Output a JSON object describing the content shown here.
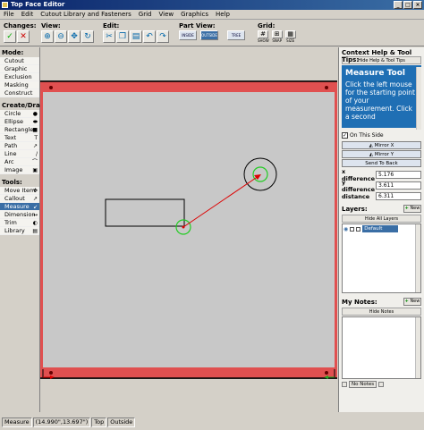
{
  "window": {
    "title": "Top Face Editor"
  },
  "menu": [
    "File",
    "Edit",
    "Cutout Library and Fasteners",
    "Grid",
    "View",
    "Graphics",
    "Help"
  ],
  "toolbar": {
    "changes_label": "Changes:",
    "view_label": "View:",
    "edit_label": "Edit:",
    "partview_label": "Part View:",
    "grid_label": "Grid:",
    "partview_buttons": [
      "INSIDE",
      "OUTSIDE",
      "TREE"
    ],
    "grid_buttons": [
      "SHOW",
      "SNAP",
      "SIZE"
    ]
  },
  "left_panel": {
    "mode_title": "Mode:",
    "mode_items": [
      "Cutout",
      "Graphic",
      "Exclusion",
      "Masking",
      "Construct"
    ],
    "create_title": "Create/Draw:",
    "create_items": [
      "Circle",
      "Ellipse",
      "Rectangle",
      "Text",
      "Path",
      "Line",
      "Arc",
      "Image"
    ],
    "tools_title": "Tools:",
    "tools_items": [
      "Move Item",
      "Callout",
      "Measure",
      "Dimension",
      "Trim",
      "Library"
    ],
    "selected_tool": "Measure"
  },
  "right_panel": {
    "help_title": "Context Help & Tool Tips:",
    "hide_help_label": "Hide Help & Tool Tips",
    "help_heading": "Measure Tool",
    "help_body": "Click the left mouse for the starting point of your measurement. Click a second",
    "on_this_side_label": "On This Side",
    "mirror_x_label": "Mirror X",
    "mirror_y_label": "Mirror Y",
    "send_to_back_label": "Send To Back",
    "x_diff_label": "x difference",
    "x_diff_value": "5.176",
    "y_diff_label": "y difference",
    "y_diff_value": "3.611",
    "distance_label": "distance",
    "distance_value": "6.311",
    "layers_title": "Layers:",
    "new_label": "New",
    "hide_layers_label": "Hide All Layers",
    "layer_name": "Default",
    "notes_title": "My Notes:",
    "hide_notes_label": "Hide Notes",
    "no_notes_label": "No Notes"
  },
  "status": [
    "Measure",
    "(14.990\",13.697\")",
    "Top",
    "Outside"
  ],
  "colors": {
    "accent": "#3a6ea5",
    "help_bg": "#1f6fb4",
    "border_red": "#e05050"
  }
}
